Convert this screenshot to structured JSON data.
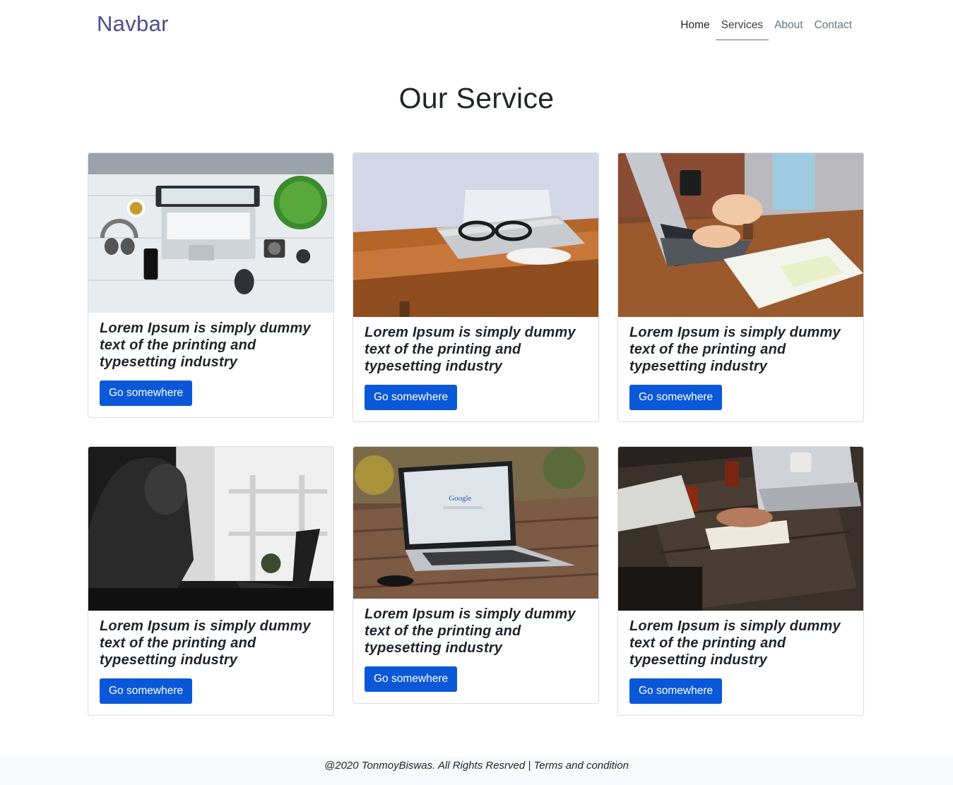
{
  "navbar": {
    "brand": "Navbar",
    "links": [
      "Home",
      "Services",
      "About",
      "Contact"
    ]
  },
  "page_title": "Our Service",
  "cards": [
    {
      "text": "Lorem Ipsum is simply dummy text of the printing and typesetting industry",
      "button": "Go somewhere",
      "image": "laptop-top-view-photo"
    },
    {
      "text": "Lorem Ipsum is simply dummy text of the printing and typesetting industry",
      "button": "Go somewhere",
      "image": "glasses-on-laptop-photo"
    },
    {
      "text": "Lorem Ipsum is simply dummy text of the printing and typesetting industry",
      "button": "Go somewhere",
      "image": "typing-on-laptop-photo"
    },
    {
      "text": "Lorem Ipsum is simply dummy text of the printing and typesetting industry",
      "button": "Go somewhere",
      "image": "woman-with-laptop-photo"
    },
    {
      "text": "Lorem Ipsum is simply dummy text of the printing and typesetting industry",
      "button": "Go somewhere",
      "image": "google-laptop-photo"
    },
    {
      "text": "Lorem Ipsum is simply dummy text of the printing and typesetting industry",
      "button": "Go somewhere",
      "image": "team-meeting-photo"
    }
  ],
  "footer": {
    "text": "@2020 TonmoyBiswas. All Rights Resrved | Terms and condition"
  }
}
